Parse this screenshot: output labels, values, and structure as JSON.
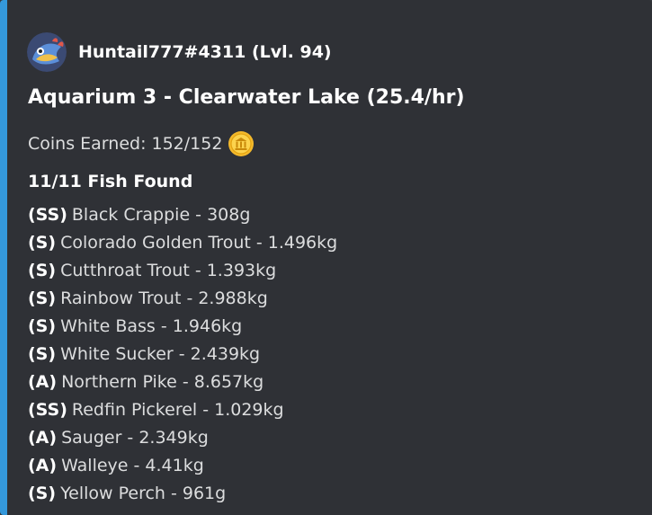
{
  "embed": {
    "accent_color": "#3498db",
    "author": {
      "name": "Huntail777#4311 (Lvl. 94)",
      "avatar_icon": "huntail-avatar-icon"
    },
    "title": "Aquarium 3 - Clearwater Lake (25.4/hr)",
    "coins": {
      "text": "Coins Earned: 152/152",
      "icon": "gold-coin-icon"
    },
    "fish_header": "11/11 Fish Found",
    "fish": [
      {
        "grade": "(SS)",
        "text": "Black Crappie - 308g"
      },
      {
        "grade": "(S)",
        "text": "Colorado Golden Trout - 1.496kg"
      },
      {
        "grade": "(S)",
        "text": "Cutthroat Trout - 1.393kg"
      },
      {
        "grade": "(S)",
        "text": "Rainbow Trout - 2.988kg"
      },
      {
        "grade": "(S)",
        "text": "White Bass - 1.946kg"
      },
      {
        "grade": "(S)",
        "text": "White Sucker - 2.439kg"
      },
      {
        "grade": "(A)",
        "text": "Northern Pike - 8.657kg"
      },
      {
        "grade": "(SS)",
        "text": "Redfin Pickerel - 1.029kg"
      },
      {
        "grade": "(A)",
        "text": "Sauger - 2.349kg"
      },
      {
        "grade": "(A)",
        "text": "Walleye - 4.41kg"
      },
      {
        "grade": "(S)",
        "text": "Yellow Perch - 961g"
      }
    ]
  }
}
